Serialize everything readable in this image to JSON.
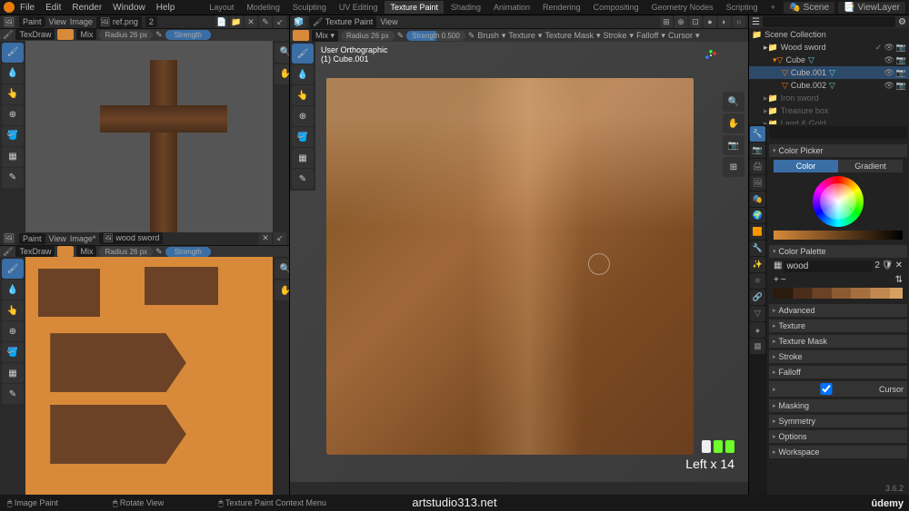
{
  "topbar": {
    "menus": [
      "File",
      "Edit",
      "Render",
      "Window",
      "Help"
    ],
    "tabs": [
      "Layout",
      "Modeling",
      "Sculpting",
      "UV Editing",
      "Texture Paint",
      "Shading",
      "Animation",
      "Rendering",
      "Compositing",
      "Geometry Nodes",
      "Scripting",
      "+"
    ],
    "active_tab": "Texture Paint",
    "scene": "Scene",
    "viewlayer": "ViewLayer"
  },
  "panelUL": {
    "hdr": {
      "mode": "Paint",
      "view": "View",
      "image": "Image",
      "imgname": "ref.png",
      "img_idx": "2"
    },
    "tb": {
      "brush": "TexDraw",
      "blend": "Mix",
      "radius_lbl": "Radius",
      "radius": "26 px",
      "strength_lbl": "Strength"
    }
  },
  "panelLL": {
    "hdr": {
      "mode": "Paint",
      "view": "View",
      "image": "Image*",
      "imgname": "wood sword"
    },
    "tb": {
      "brush": "TexDraw",
      "blend": "Mix",
      "radius_lbl": "Radius",
      "radius": "26 px",
      "strength_lbl": "Strength"
    }
  },
  "mid": {
    "hdr": {
      "mode": "Texture Paint",
      "view": "View"
    },
    "tb": {
      "blend": "Mix",
      "radius_lbl": "Radius",
      "radius": "26 px",
      "strength_lbl": "Strength",
      "strength": "0.500",
      "brush": "Brush",
      "texture": "Texture",
      "texmask": "Texture Mask",
      "stroke": "Stroke",
      "falloff": "Falloff",
      "cursor": "Cursor"
    },
    "overlay_line1": "User Orthographic",
    "overlay_line2": "(1) Cube.001",
    "mouse_txt": "Left x 14"
  },
  "outliner": {
    "search": "",
    "scene_collection": "Scene Collection",
    "items": [
      {
        "name": "Wood sword",
        "type": "collection",
        "depth": 0
      },
      {
        "name": "Cube",
        "type": "mesh",
        "depth": 1
      },
      {
        "name": "Cube.001",
        "type": "mesh",
        "depth": 2,
        "selected": true
      },
      {
        "name": "Cube.002",
        "type": "mesh",
        "depth": 2
      },
      {
        "name": "Iron sword",
        "type": "collection",
        "depth": 0,
        "dim": true
      },
      {
        "name": "Treasure box",
        "type": "collection",
        "depth": 0,
        "dim": true
      },
      {
        "name": "Land & Gold",
        "type": "collection",
        "depth": 0,
        "dim": true
      }
    ]
  },
  "props": {
    "search": "",
    "colorpicker": {
      "title": "Color Picker",
      "color_tab": "Color",
      "grad_tab": "Gradient"
    },
    "colorpalette": {
      "title": "Color Palette",
      "name": "wood",
      "idx": "2"
    },
    "sections": [
      "Advanced",
      "Texture",
      "Texture Mask",
      "Stroke",
      "Falloff",
      "Cursor",
      "Masking",
      "Symmetry",
      "Options",
      "Workspace"
    ],
    "cursor_checked": true
  },
  "status": {
    "left": "Image Paint",
    "mid": "Rotate View",
    "right": "Texture Paint Context Menu"
  },
  "version": "3.6.2",
  "watermark": "artstudio313.net",
  "udemy": "ûdemy"
}
